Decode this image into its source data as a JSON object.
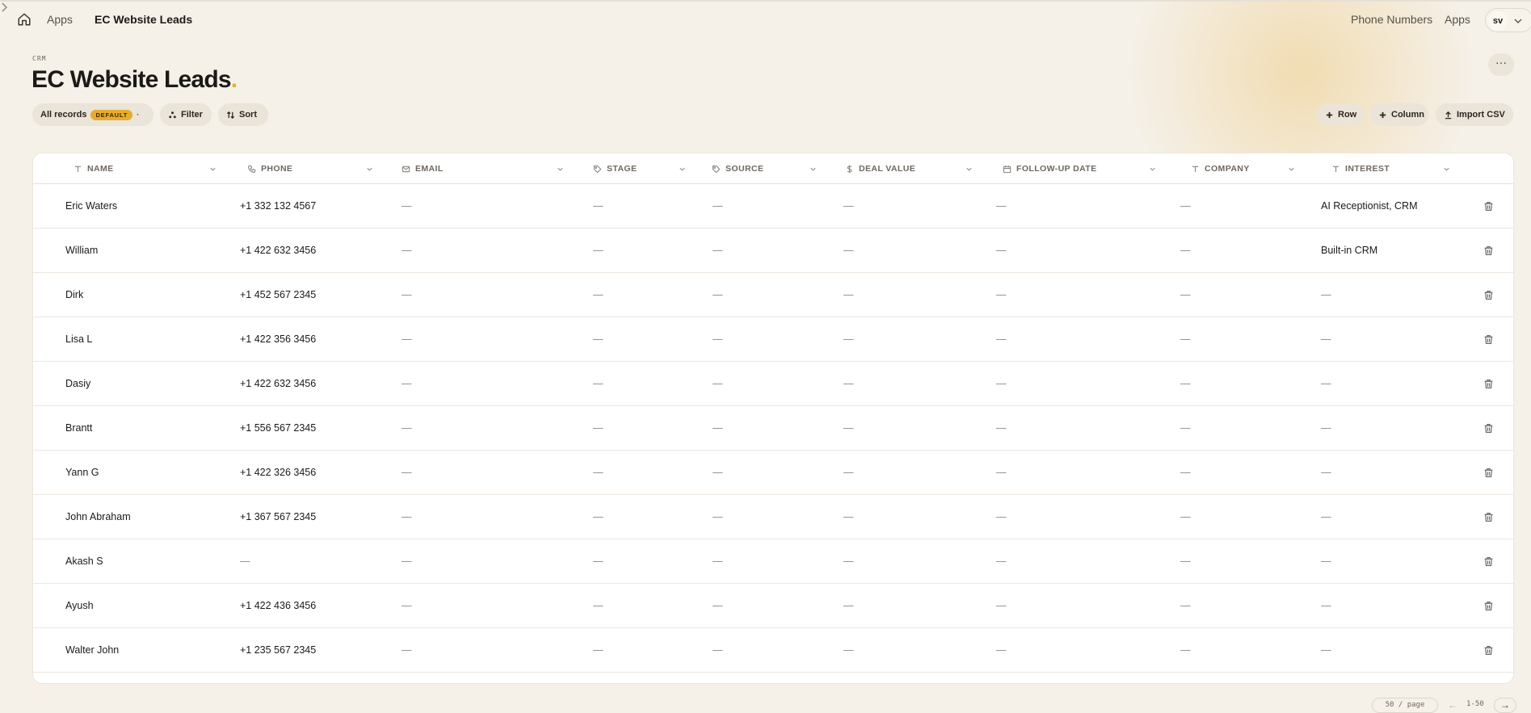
{
  "breadcrumb": {
    "home_icon": "home-icon",
    "apps": "Apps",
    "current": "EC Website Leads"
  },
  "nav": {
    "phone_numbers": "Phone Numbers",
    "apps": "Apps",
    "avatar": "sv"
  },
  "header": {
    "eyebrow": "CRM",
    "title": "EC Website Leads",
    "title_dot": ".",
    "more": "···"
  },
  "toolbar": {
    "view_label": "All records",
    "view_badge": "DEFAULT",
    "view_dot": "·",
    "filter": "Filter",
    "sort": "Sort",
    "add_row": "Row",
    "add_column": "Column",
    "import_csv": "Import CSV"
  },
  "columns": [
    {
      "label": "NAME",
      "icon": "text-icon"
    },
    {
      "label": "PHONE",
      "icon": "phone-icon"
    },
    {
      "label": "EMAIL",
      "icon": "mail-icon"
    },
    {
      "label": "STAGE",
      "icon": "tag-icon"
    },
    {
      "label": "SOURCE",
      "icon": "tag-icon"
    },
    {
      "label": "DEAL VALUE",
      "icon": "dollar-icon"
    },
    {
      "label": "FOLLOW-UP DATE",
      "icon": "calendar-icon"
    },
    {
      "label": "COMPANY",
      "icon": "text-icon"
    },
    {
      "label": "INTEREST",
      "icon": "text-icon"
    }
  ],
  "rows": [
    [
      "Eric Waters",
      "+1 332 132 4567",
      "—",
      "—",
      "—",
      "—",
      "—",
      "—",
      "AI Receptionist, CRM"
    ],
    [
      "William",
      "+1 422 632 3456",
      "—",
      "—",
      "—",
      "—",
      "—",
      "—",
      "Built-in CRM"
    ],
    [
      "Dirk",
      "+1 452 567 2345",
      "—",
      "—",
      "—",
      "—",
      "—",
      "—",
      "—"
    ],
    [
      "Lisa L",
      "+1 422 356 3456",
      "—",
      "—",
      "—",
      "—",
      "—",
      "—",
      "—"
    ],
    [
      "Dasiy",
      "+1 422 632 3456",
      "—",
      "—",
      "—",
      "—",
      "—",
      "—",
      "—"
    ],
    [
      "Brantt",
      "+1 556 567 2345",
      "—",
      "—",
      "—",
      "—",
      "—",
      "—",
      "—"
    ],
    [
      "Yann G",
      "+1 422 326 3456",
      "—",
      "—",
      "—",
      "—",
      "—",
      "—",
      "—"
    ],
    [
      "John Abraham",
      "+1 367 567 2345",
      "—",
      "—",
      "—",
      "—",
      "—",
      "—",
      "—"
    ],
    [
      "Akash S",
      "—",
      "—",
      "—",
      "—",
      "—",
      "—",
      "—",
      "—"
    ],
    [
      "Ayush",
      "+1 422 436 3456",
      "—",
      "—",
      "—",
      "—",
      "—",
      "—",
      "—"
    ],
    [
      "Walter John",
      "+1 235 567 2345",
      "—",
      "—",
      "—",
      "—",
      "—",
      "—",
      "—"
    ]
  ],
  "pagination": {
    "per_page": "50 / page",
    "prev": "←",
    "range": "1-50",
    "next": "→"
  },
  "colors": {
    "background": "#f5f0e8",
    "accent": "#e7b02c",
    "badge": "#e6ac2d"
  }
}
